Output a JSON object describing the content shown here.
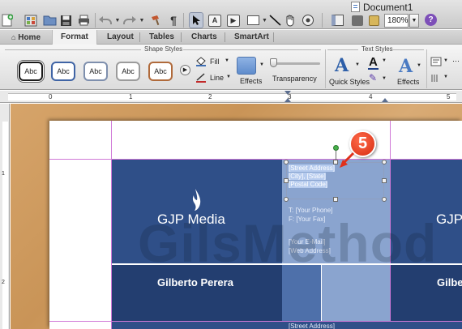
{
  "window": {
    "document_title": "Document1",
    "zoom": "180%",
    "help_label": "?"
  },
  "ribbon": {
    "tabs": [
      "Home",
      "Format",
      "Layout",
      "Tables",
      "Charts",
      "SmartArt"
    ],
    "selected_tab": "Format",
    "groups": {
      "shape_styles": "Shape Styles",
      "text_styles": "Text Styles"
    },
    "style_samples": [
      "Abc",
      "Abc",
      "Abc",
      "Abc",
      "Abc"
    ],
    "style_colors": [
      "#1a1a1a",
      "#3f64a5",
      "#7e8fad",
      "#9b9b9b",
      "#b06a3b"
    ],
    "fill_label": "Fill",
    "line_label": "Line",
    "effects_label": "Effects",
    "transparency_label": "Transparency",
    "transparency_value": 0,
    "quick_styles_label": "Quick Styles",
    "text_effects_label": "Effects"
  },
  "ruler": {
    "marks": [
      "0",
      "1",
      "2",
      "3",
      "4",
      "5"
    ]
  },
  "document": {
    "card1": {
      "company": "GJP Media",
      "name": "Gilberto Perera",
      "address_selected": [
        "[Street Address]",
        "[City], [State]",
        "[Postal Code]"
      ],
      "phone": "T: [Your Phone]",
      "fax": "F: [Your Fax]",
      "email": "[Your E-Mail]",
      "web": "[Web Address]"
    },
    "card2": {
      "company": "GJP",
      "name": "Gilbe"
    },
    "card3": {
      "address": "[Street Address]"
    }
  },
  "watermark": "GilsMethod",
  "callout": "5"
}
